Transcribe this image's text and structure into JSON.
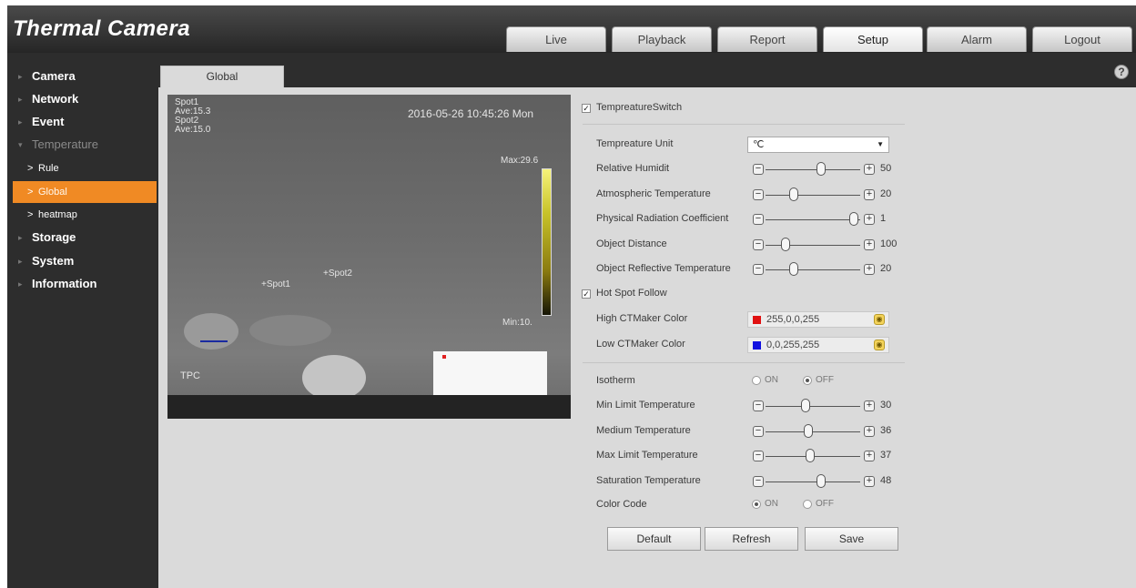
{
  "app_title": "Thermal Camera",
  "nav_tabs": [
    {
      "label": "Live",
      "active": false
    },
    {
      "label": "Playback",
      "active": false
    },
    {
      "label": "Report",
      "active": false
    },
    {
      "label": "Setup",
      "active": true
    },
    {
      "label": "Alarm",
      "active": false
    },
    {
      "label": "Logout",
      "active": false
    }
  ],
  "sidebar": {
    "items": [
      {
        "label": "Camera"
      },
      {
        "label": "Network"
      },
      {
        "label": "Event"
      },
      {
        "label": "Temperature"
      },
      {
        "label": "Rule"
      },
      {
        "label": "Global",
        "active": true
      },
      {
        "label": "heatmap"
      },
      {
        "label": "Storage"
      },
      {
        "label": "System"
      },
      {
        "label": "Information"
      }
    ]
  },
  "tab": {
    "label": "Global"
  },
  "help_icon": "?",
  "video": {
    "osd_lines": [
      "Spot1",
      "Ave:15.3",
      "Spot2",
      "Ave:15.0"
    ],
    "timestamp": "2016-05-26 10:45:26 Mon",
    "max_label": "Max:29.6",
    "min_label": "Min:10.",
    "spot1_label": "+Spot1",
    "spot2_label": "+Spot2",
    "channel_label": "TPC"
  },
  "settings": {
    "temp_switch": {
      "label": "TempreatureSwitch",
      "checked": true
    },
    "temp_unit": {
      "label": "Tempreature Unit",
      "value": "℃"
    },
    "sliders": [
      {
        "label": "Relative Humidit",
        "value": "50",
        "pos": 0.6
      },
      {
        "label": "Atmospheric Temperature",
        "value": "20",
        "pos": 0.28
      },
      {
        "label": "Physical Radiation Coefficient",
        "value": "1",
        "pos": 0.98
      },
      {
        "label": "Object Distance",
        "value": "100",
        "pos": 0.18
      },
      {
        "label": "Object Reflective Temperature",
        "value": "20",
        "pos": 0.28
      }
    ],
    "hot_spot_follow": {
      "label": "Hot Spot Follow",
      "checked": true
    },
    "high_color": {
      "label": "High CTMaker Color",
      "value": "255,0,0,255",
      "swatch": "#e01010"
    },
    "low_color": {
      "label": "Low CTMaker Color",
      "value": "0,0,255,255",
      "swatch": "#1010e0"
    },
    "isotherm": {
      "label": "Isotherm",
      "on_label": "ON",
      "off_label": "OFF",
      "value": "OFF"
    },
    "iso_sliders": [
      {
        "label": "Min Limit Temperature",
        "value": "30",
        "pos": 0.42
      },
      {
        "label": "Medium Temperature",
        "value": "36",
        "pos": 0.45
      },
      {
        "label": "Max Limit Temperature",
        "value": "37",
        "pos": 0.47
      },
      {
        "label": "Saturation Temperature",
        "value": "48",
        "pos": 0.6
      }
    ],
    "color_code": {
      "label": "Color Code",
      "on_label": "ON",
      "off_label": "OFF",
      "value": "ON"
    }
  },
  "buttons": {
    "default": "Default",
    "refresh": "Refresh",
    "save": "Save"
  }
}
